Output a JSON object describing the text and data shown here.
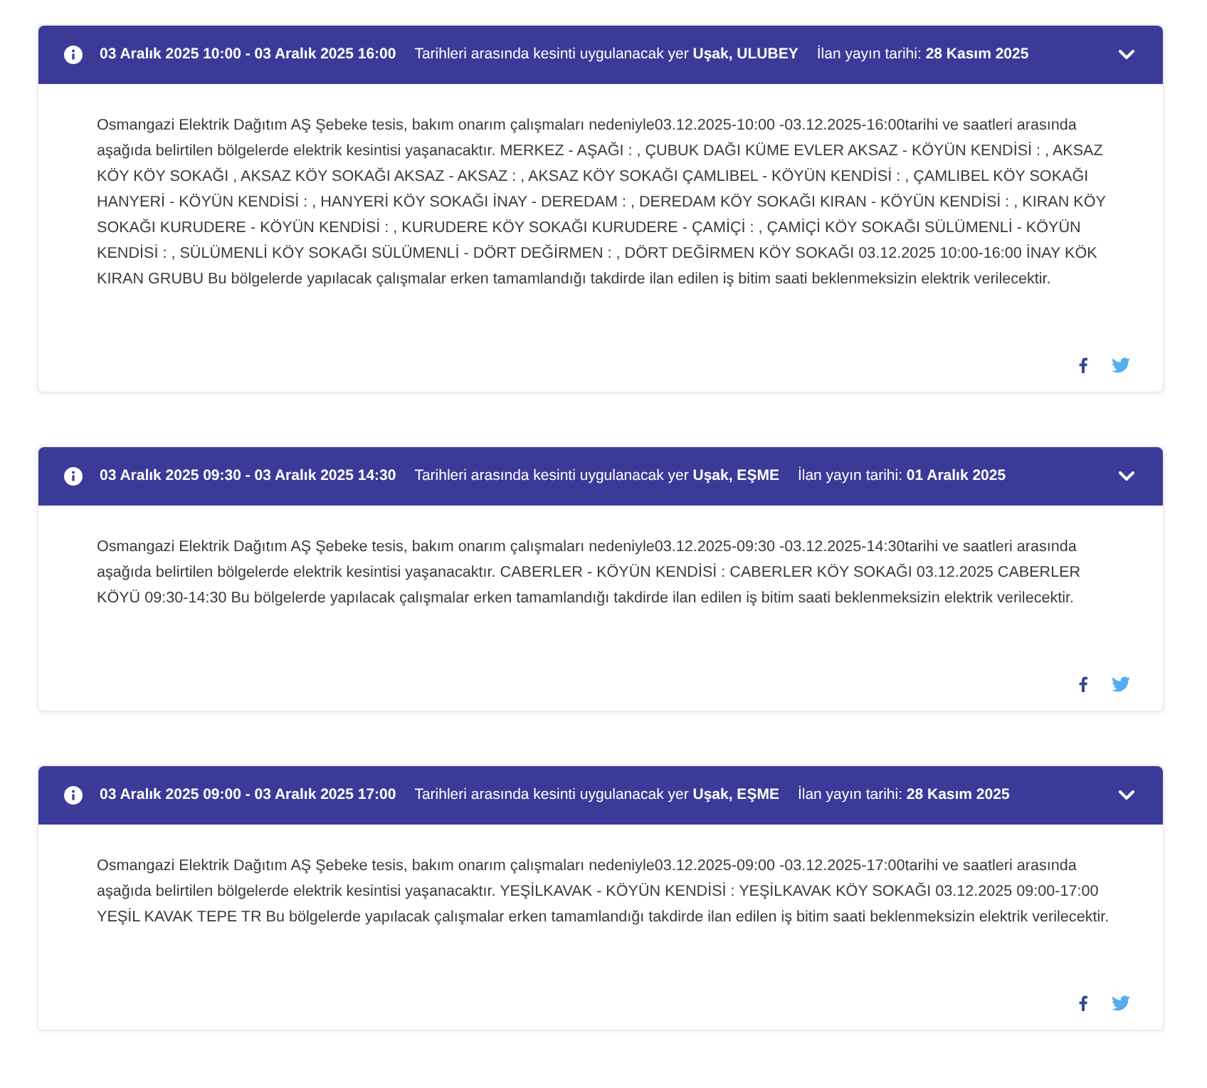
{
  "notices": [
    {
      "header": {
        "date_range": "03 Aralık 2025 10:00 - 03 Aralık 2025 16:00",
        "location_text": "Tarihleri arasında kesinti uygulanacak yer **Uşak, ULUBEY**",
        "published_text": "İlan yayın tarihi: **28 Kasım 2025**"
      },
      "body": "Osmangazi Elektrik Dağıtım AŞ Şebeke tesis, bakım onarım çalışmaları nedeniyle03.12.2025-10:00 -03.12.2025-16:00tarihi ve saatleri arasında aşağıda belirtilen bölgelerde elektrik kesintisi yaşanacaktır. MERKEZ - AŞAĞI : , ÇUBUK DAĞI KÜME EVLER AKSAZ - KÖYÜN KENDİSİ : , AKSAZ KÖY KÖY SOKAĞI , AKSAZ KÖY SOKAĞI AKSAZ - AKSAZ : , AKSAZ KÖY SOKAĞI ÇAMLIBEL - KÖYÜN KENDİSİ : , ÇAMLIBEL KÖY SOKAĞI HANYERİ - KÖYÜN KENDİSİ : , HANYERİ KÖY SOKAĞI İNAY - DEREDAM : , DEREDAM KÖY SOKAĞI KIRAN - KÖYÜN KENDİSİ : , KIRAN KÖY SOKAĞI KURUDERE - KÖYÜN KENDİSİ : , KURUDERE KÖY SOKAĞI KURUDERE - ÇAMİÇİ : , ÇAMİÇİ KÖY SOKAĞI SÜLÜMENLİ - KÖYÜN KENDİSİ : , SÜLÜMENLİ KÖY SOKAĞI SÜLÜMENLİ - DÖRT DEĞİRMEN : , DÖRT DEĞİRMEN KÖY SOKAĞI 03.12.2025 10:00-16:00 İNAY KÖK KIRAN GRUBU Bu bölgelerde yapılacak çalışmalar erken tamamlandığı takdirde ilan edilen iş bitim saati beklenmeksizin elektrik verilecektir."
    },
    {
      "header": {
        "date_range": "03 Aralık 2025 09:30 - 03 Aralık 2025 14:30",
        "location_text": "Tarihleri arasında kesinti uygulanacak yer **Uşak, EŞME**",
        "published_text": "İlan yayın tarihi: **01 Aralık 2025**"
      },
      "body": "Osmangazi Elektrik Dağıtım AŞ Şebeke tesis, bakım onarım çalışmaları nedeniyle03.12.2025-09:30 -03.12.2025-14:30tarihi ve saatleri arasında aşağıda belirtilen bölgelerde elektrik kesintisi yaşanacaktır. CABERLER - KÖYÜN KENDİSİ : CABERLER KÖY SOKAĞI 03.12.2025 CABERLER KÖYÜ 09:30-14:30 Bu bölgelerde yapılacak çalışmalar erken tamamlandığı takdirde ilan edilen iş bitim saati beklenmeksizin elektrik verilecektir."
    },
    {
      "header": {
        "date_range": "03 Aralık 2025 09:00 - 03 Aralık 2025 17:00",
        "location_text": "Tarihleri arasında kesinti uygulanacak yer **Uşak, EŞME**",
        "published_text": "İlan yayın tarihi: **28 Kasım 2025**"
      },
      "body": "Osmangazi Elektrik Dağıtım AŞ Şebeke tesis, bakım onarım çalışmaları nedeniyle03.12.2025-09:00 -03.12.2025-17:00tarihi ve saatleri arasında aşağıda belirtilen bölgelerde elektrik kesintisi yaşanacaktır. YEŞİLKAVAK - KÖYÜN KENDİSİ : YEŞİLKAVAK KÖY SOKAĞI 03.12.2025 09:00-17:00 YEŞİL KAVAK TEPE TR Bu bölgelerde yapılacak çalışmalar erken tamamlandığı takdirde ilan edilen iş bitim saati beklenmeksizin elektrik verilecektir."
    }
  ]
}
